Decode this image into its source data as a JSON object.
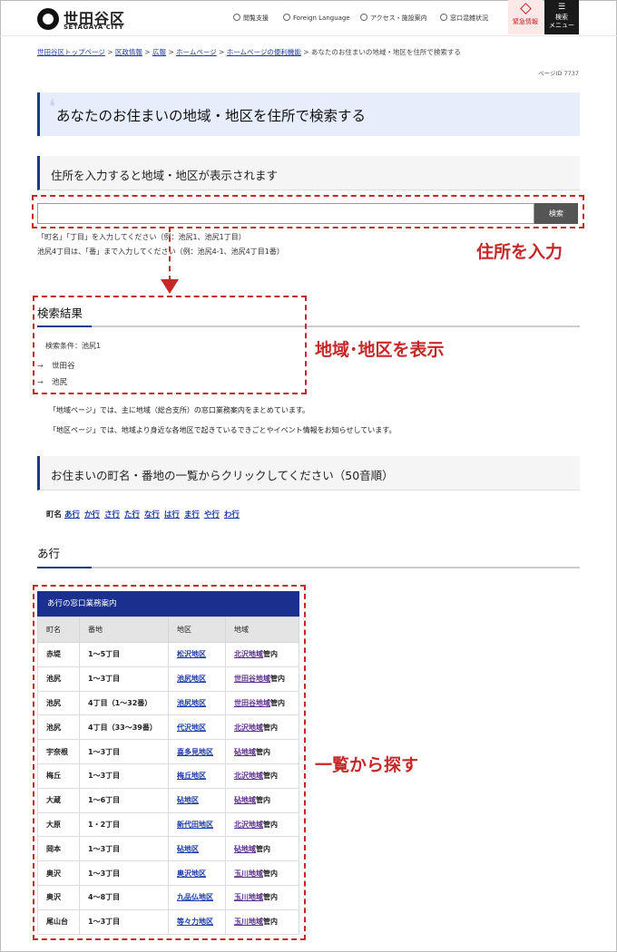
{
  "header": {
    "logo_jp": "世田谷区",
    "logo_en": "SETAGAYA CITY",
    "nav": [
      "閲覧支援",
      "Foreign Language",
      "アクセス・施設案内",
      "窓口混雑状況"
    ],
    "emergency_label": "緊急情報",
    "menu_label_1": "検索",
    "menu_label_2": "メニュー"
  },
  "breadcrumb": {
    "links": [
      "世田谷区トップページ",
      "区政情報",
      "広報",
      "ホームページ",
      "ホームページの便利機能"
    ],
    "current": "あなたのお住まいの地域・地区を住所で検索する"
  },
  "page_id": "ページID 7737",
  "page_title": "あなたのお住まいの地域・地区を住所で検索する",
  "search": {
    "heading": "住所を入力すると地域・地区が表示されます",
    "value": "",
    "button_label": "検索",
    "hint1": "「町名」「丁目」を入力してください（例：池尻1、池尻1丁目）",
    "hint2": "池尻4丁目は、「番」まで入力してください（例：池尻4-1、池尻4丁目1番）"
  },
  "annotations": {
    "input": "住所を入力",
    "result": "地域･地区を表示",
    "list": "一覧から探す"
  },
  "results": {
    "title": "検索結果",
    "condition": "検索条件：池尻1",
    "items": [
      "世田谷",
      "池尻"
    ]
  },
  "notes": [
    "「地域ページ」では、主に地域（総合支所）の窓口業務案内をまとめています。",
    "「地区ページ」では、地域より身近な各地区で起きているできごとやイベント情報をお知らせしています。"
  ],
  "list_heading": "お住まいの町名・番地の一覧からクリックしてください（50音順）",
  "kana_nav": {
    "label": "町名",
    "links": [
      "あ行",
      "か行",
      "さ行",
      "た行",
      "な行",
      "は行",
      "ま行",
      "や行",
      "わ行"
    ]
  },
  "section_a": {
    "title": "あ行",
    "table_caption": "あ行の窓口業務案内",
    "columns": [
      "町名",
      "番地",
      "地区",
      "地域"
    ],
    "rows": [
      [
        "赤堤",
        "1～5丁目",
        "松沢地区",
        "北沢地域",
        "管内"
      ],
      [
        "池尻",
        "1～3丁目",
        "池尻地区",
        "世田谷地域",
        "管内"
      ],
      [
        "池尻",
        "4丁目（1～32番）",
        "池尻地区",
        "世田谷地域",
        "管内"
      ],
      [
        "池尻",
        "4丁目（33～39番）",
        "代沢地区",
        "北沢地域",
        "管内"
      ],
      [
        "宇奈根",
        "1～3丁目",
        "喜多見地区",
        "砧地域",
        "管内"
      ],
      [
        "梅丘",
        "1～3丁目",
        "梅丘地区",
        "北沢地域",
        "管内"
      ],
      [
        "大蔵",
        "1～6丁目",
        "砧地区",
        "砧地域",
        "管内"
      ],
      [
        "大原",
        "1・2丁目",
        "新代田地区",
        "北沢地域",
        "管内"
      ],
      [
        "岡本",
        "1～3丁目",
        "砧地区",
        "砧地域",
        "管内"
      ],
      [
        "奥沢",
        "1～3丁目",
        "奥沢地区",
        "玉川地域",
        "管内"
      ],
      [
        "奥沢",
        "4～8丁目",
        "九品仏地区",
        "玉川地域",
        "管内"
      ],
      [
        "尾山台",
        "1～3丁目",
        "等々力地区",
        "玉川地域",
        "管内"
      ]
    ]
  },
  "colors": {
    "accent": "#1a3a8a",
    "annotation_red": "#c62828",
    "table_header": "#1b2f8f"
  }
}
